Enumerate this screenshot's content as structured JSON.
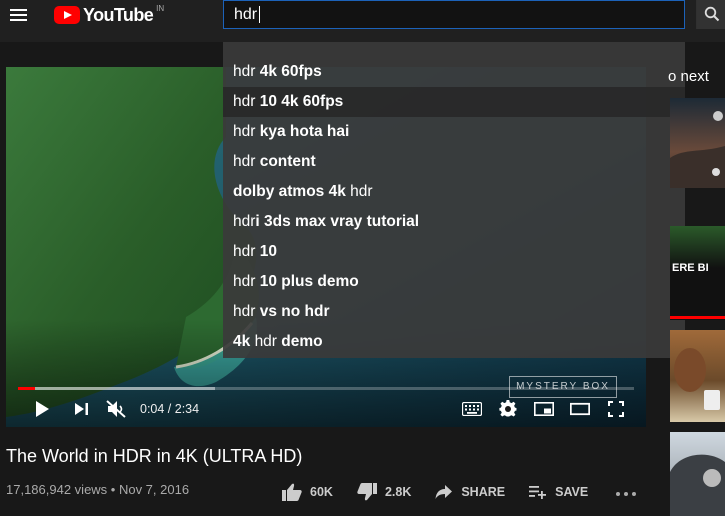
{
  "header": {
    "logo_text": "YouTube",
    "region": "IN",
    "search_value": "hdr"
  },
  "suggestions": [
    {
      "prefix": "hdr",
      "rest": " 4k 60fps"
    },
    {
      "prefix": "hdr",
      "rest": " 10 4k 60fps"
    },
    {
      "prefix": "hdr",
      "rest": " kya hota hai"
    },
    {
      "prefix": "hdr",
      "rest": " content"
    },
    {
      "prefix": "",
      "rest": "dolby atmos 4k ",
      "suffix": "hdr"
    },
    {
      "prefix": "hdr",
      "rest": "i 3ds max vray tutorial"
    },
    {
      "prefix": "hdr",
      "rest": " 10"
    },
    {
      "prefix": "hdr",
      "rest": " 10 plus demo"
    },
    {
      "prefix": "hdr",
      "rest": " vs no hdr"
    },
    {
      "prefix": "",
      "rest": "4k ",
      "suffix": "hdr",
      "tail": " demo"
    }
  ],
  "player": {
    "time": "0:04 / 2:34",
    "watermark": "MYSTERY BOX",
    "progress_played": 0.027,
    "progress_buffered": 0.32
  },
  "video": {
    "title": "The World in HDR in 4K (ULTRA HD)",
    "meta": "17,186,942 views • Nov 7, 2016",
    "likes": "60K",
    "dislikes": "2.8K",
    "share_label": "SHARE",
    "save_label": "SAVE"
  },
  "sidebar": {
    "upnext_label": "o next",
    "thumb2_text": "ERE BI"
  },
  "colors": {
    "accent": "#ff0000",
    "search_border": "#1c62b9",
    "background": "#181818"
  }
}
